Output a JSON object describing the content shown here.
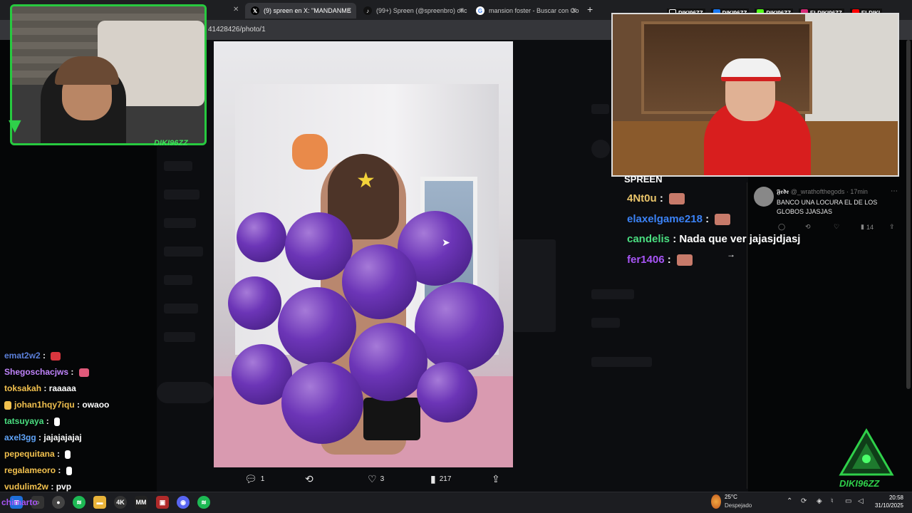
{
  "browser": {
    "tabs": [
      {
        "title": "(9) spreen en X: \"MANDANME",
        "icon": "x-icon",
        "active": true
      },
      {
        "title": "(99+) Spreen (@spreenbro) ofic",
        "icon": "tiktok-icon",
        "active": false
      },
      {
        "title": "mansion foster - Buscar con Go",
        "icon": "google-icon",
        "active": false
      }
    ],
    "new_tab": "+",
    "url": "41428426/photo/1"
  },
  "tweet_actions": {
    "replies": "1",
    "likes": "3",
    "views": "217"
  },
  "overlay": {
    "streamer_label": "DIKI96ZZ",
    "logo_label": "DIKI96ZZ",
    "social": [
      "DIKI96ZZ",
      "DIKI96ZZ",
      "DIKI96ZZ",
      "ELDIKI96ZZ",
      "ELDIKI"
    ],
    "right_chat_title": "SPREEN"
  },
  "right_chat": [
    {
      "user": "4Nt0u",
      "color": "#e9c46a",
      "message": "",
      "emote": true
    },
    {
      "user": "elaxelgame218",
      "color": "#3b82f6",
      "message": "",
      "emote": true
    },
    {
      "user": "candelis",
      "color": "#4ade80",
      "message": "Nada que ver jajasjdjasj",
      "emote": false
    },
    {
      "user": "fer1406",
      "color": "#a855f7",
      "message": "",
      "emote": true
    }
  ],
  "reply": {
    "name": "𝕱𝖊𝖉𝖊",
    "handle": "@_wrathofthegods · 17min",
    "text": "BANCO UNA LOCURA EL DE LOS GLOBOS JJASJAS",
    "views": "14"
  },
  "left_chat": [
    {
      "user": "emat2w2",
      "color": "#5b7fd9",
      "message": "",
      "emote": "#d9363e"
    },
    {
      "user": "Shegoschacjws",
      "color": "#c084fc",
      "message": "",
      "emote": "#e05a7a"
    },
    {
      "user": "toksakah",
      "color": "#f2c14e",
      "message": "raaaaa",
      "emote": ""
    },
    {
      "user": "johan1hqy7iqu",
      "color": "#f2c14e",
      "message": "owaoo",
      "emote": ""
    },
    {
      "user": "tatsuyaya",
      "color": "#4ade80",
      "message": "",
      "emote": "#ffffff"
    },
    {
      "user": "axel3gg",
      "color": "#60a5fa",
      "message": "jajajajajaj",
      "emote": ""
    },
    {
      "user": "pepequitana",
      "color": "#f2c14e",
      "message": "",
      "emote": "#ffffff"
    },
    {
      "user": "regalameoro",
      "color": "#f2c14e",
      "message": "",
      "emote": "#ffffff"
    },
    {
      "user": "vudulim2w",
      "color": "#f2c14e",
      "message": "pvp",
      "emote": ""
    },
    {
      "user": "chimarto",
      "color": "#a855f7",
      "message": "",
      "emote": ""
    }
  ],
  "taskbar": {
    "weather_temp": "25°C",
    "weather_desc": "Despejado",
    "time": "20:58",
    "date": "31/10/2025"
  }
}
